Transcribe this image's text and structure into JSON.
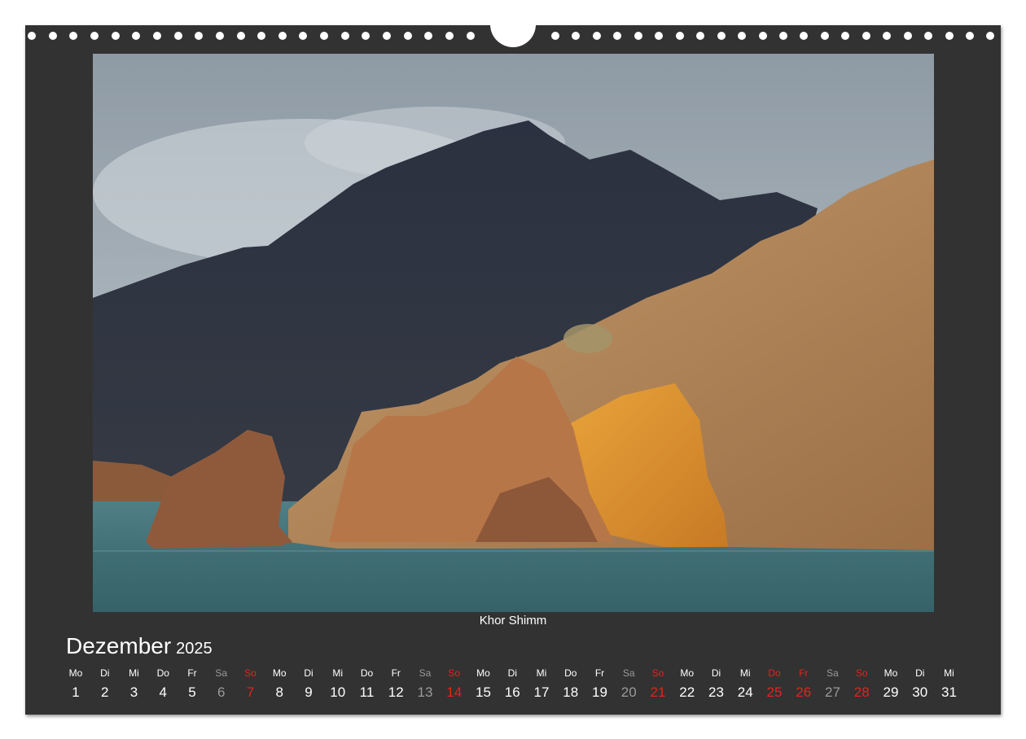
{
  "caption": "Khor Shimm",
  "month": {
    "name": "Dezember",
    "year": "2025"
  },
  "colors": {
    "frame": "#323232",
    "text": "#ffffff",
    "saturday": "#9a9a9a",
    "holiday": "#e1251b"
  },
  "days": [
    {
      "wd": "Mo",
      "d": "1",
      "t": "n"
    },
    {
      "wd": "Di",
      "d": "2",
      "t": "n"
    },
    {
      "wd": "Mi",
      "d": "3",
      "t": "n"
    },
    {
      "wd": "Do",
      "d": "4",
      "t": "n"
    },
    {
      "wd": "Fr",
      "d": "5",
      "t": "n"
    },
    {
      "wd": "Sa",
      "d": "6",
      "t": "sat"
    },
    {
      "wd": "So",
      "d": "7",
      "t": "red"
    },
    {
      "wd": "Mo",
      "d": "8",
      "t": "n"
    },
    {
      "wd": "Di",
      "d": "9",
      "t": "n"
    },
    {
      "wd": "Mi",
      "d": "10",
      "t": "n"
    },
    {
      "wd": "Do",
      "d": "11",
      "t": "n"
    },
    {
      "wd": "Fr",
      "d": "12",
      "t": "n"
    },
    {
      "wd": "Sa",
      "d": "13",
      "t": "sat"
    },
    {
      "wd": "So",
      "d": "14",
      "t": "red"
    },
    {
      "wd": "Mo",
      "d": "15",
      "t": "n"
    },
    {
      "wd": "Di",
      "d": "16",
      "t": "n"
    },
    {
      "wd": "Mi",
      "d": "17",
      "t": "n"
    },
    {
      "wd": "Do",
      "d": "18",
      "t": "n"
    },
    {
      "wd": "Fr",
      "d": "19",
      "t": "n"
    },
    {
      "wd": "Sa",
      "d": "20",
      "t": "sat"
    },
    {
      "wd": "So",
      "d": "21",
      "t": "red"
    },
    {
      "wd": "Mo",
      "d": "22",
      "t": "n"
    },
    {
      "wd": "Di",
      "d": "23",
      "t": "n"
    },
    {
      "wd": "Mi",
      "d": "24",
      "t": "n"
    },
    {
      "wd": "Do",
      "d": "25",
      "t": "red"
    },
    {
      "wd": "Fr",
      "d": "26",
      "t": "red"
    },
    {
      "wd": "Sa",
      "d": "27",
      "t": "sat"
    },
    {
      "wd": "So",
      "d": "28",
      "t": "red"
    },
    {
      "wd": "Mo",
      "d": "29",
      "t": "n"
    },
    {
      "wd": "Di",
      "d": "30",
      "t": "n"
    },
    {
      "wd": "Mi",
      "d": "31",
      "t": "n"
    }
  ]
}
